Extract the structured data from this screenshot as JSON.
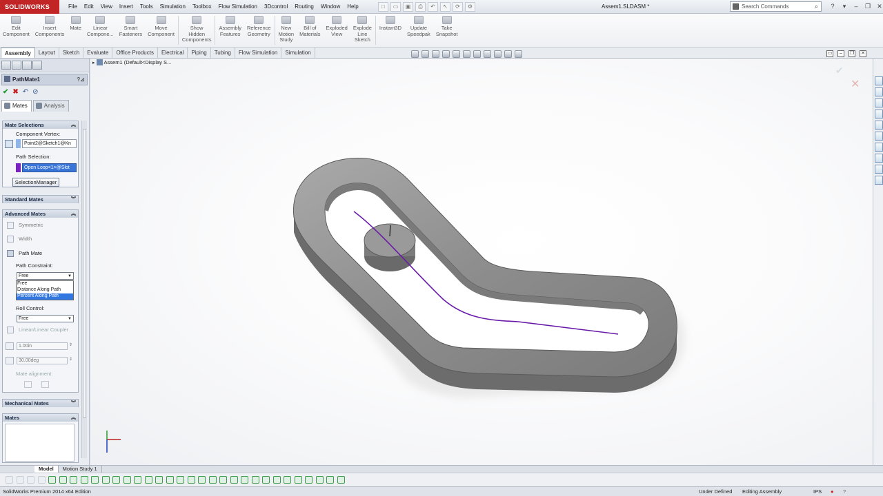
{
  "app": {
    "logo": "SOLIDWORKS",
    "document_title": "Assem1.SLDASM *"
  },
  "menus": [
    "File",
    "Edit",
    "View",
    "Insert",
    "Tools",
    "Simulation",
    "Toolbox",
    "Flow Simulation",
    "3Dcontrol",
    "Routing",
    "Window",
    "Help"
  ],
  "search": {
    "placeholder": "Search Commands"
  },
  "commands": [
    {
      "label": "Edit\nComponent"
    },
    {
      "label": "Insert\nComponents"
    },
    {
      "label": "Mate"
    },
    {
      "label": "Linear\nCompone..."
    },
    {
      "label": "Smart\nFasteners"
    },
    {
      "label": "Move\nComponent"
    },
    {
      "label": "Show\nHidden\nComponents"
    },
    {
      "label": "Assembly\nFeatures"
    },
    {
      "label": "Reference\nGeometry"
    },
    {
      "label": "New\nMotion\nStudy"
    },
    {
      "label": "Bill of\nMaterials"
    },
    {
      "label": "Exploded\nView"
    },
    {
      "label": "Explode\nLine\nSketch"
    },
    {
      "label": "Instant3D"
    },
    {
      "label": "Update\nSpeedpak"
    },
    {
      "label": "Take\nSnapshot"
    }
  ],
  "command_tabs": [
    "Assembly",
    "Layout",
    "Sketch",
    "Evaluate",
    "Office Products",
    "Electrical",
    "Piping",
    "Tubing",
    "Flow Simulation",
    "Simulation"
  ],
  "tree": {
    "root": "Assem1 (Default<Display S..."
  },
  "property_manager": {
    "title": "PathMate1",
    "tabs": {
      "mates": "Mates",
      "analysis": "Analysis"
    },
    "mate_selections": {
      "header": "Mate Selections",
      "component_vertex_label": "Component Vertex:",
      "component_vertex_value": "Point2@Sketch1@Kn",
      "path_selection_label": "Path Selection:",
      "path_selection_value": "Open Loop<1>@Slot",
      "selection_manager_button": "SelectionManager"
    },
    "standard_mates_header": "Standard Mates",
    "advanced_mates": {
      "header": "Advanced Mates",
      "symmetric": "Symmetric",
      "width": "Width",
      "path_mate": "Path Mate",
      "path_constraint_label": "Path Constraint:",
      "path_constraint_value": "Free",
      "path_constraint_options": [
        "Free",
        "Distance Along Path",
        "Percent Along Path"
      ],
      "roll_control_label": "Roll Control:",
      "roll_control_value": "Free",
      "linear_coupler": "Linear/Linear Coupler",
      "distance_value": "1.00in",
      "angle_value": "30.00deg",
      "mate_alignment": "Mate alignment:"
    },
    "mechanical_mates_header": "Mechanical Mates",
    "mates_header": "Mates"
  },
  "bottom_tabs": [
    "Model",
    "Motion Study 1"
  ],
  "status": {
    "edition": "SolidWorks Premium 2014 x64 Edition",
    "definition": "Under Defined",
    "mode": "Editing Assembly",
    "units": "IPS"
  },
  "colors": {
    "accent": "#c22526",
    "path": "#6a1aa8",
    "selection": "#3875d7",
    "model": "#8a8a8a"
  }
}
